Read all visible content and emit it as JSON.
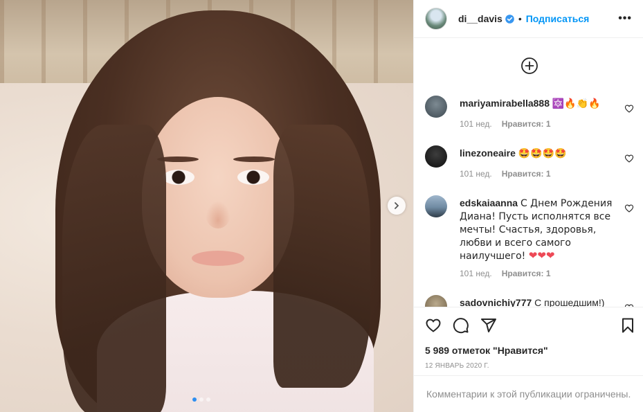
{
  "post": {
    "username": "di__davis",
    "separator": "•",
    "follow_label": "Подписаться",
    "more_label": "•••",
    "likes_text": "5 989 отметок \"Нравится\"",
    "date_text": "12 ЯНВАРЬ 2020 Г.",
    "comments_restricted": "Комментарии к этой публикации ограничены."
  },
  "comments": [
    {
      "user": "mariyamirabella888",
      "text": "🔯🔥👏🔥",
      "time": "101 нед.",
      "likes": "Нравится: 1"
    },
    {
      "user": "linezoneaire",
      "text": "🤩🤩🤩🤩",
      "time": "101 нед.",
      "likes": "Нравится: 1"
    },
    {
      "user": "edskaiaanna",
      "text": "С Днем Рождения Диана! Пусть исполнятся все мечты! Счастья, здоровья, любви и всего самого наилучшего! ❤❤❤",
      "time": "101 нед.",
      "likes": "Нравится: 1"
    },
    {
      "user": "sadovnichiy777",
      "text": "С прошедшим!)",
      "time": "",
      "likes": ""
    }
  ],
  "carousel": {
    "total": 3,
    "current": 1
  },
  "colors": {
    "accent": "#0095f6",
    "verified": "#3897f0",
    "muted": "#8e8e8e",
    "heart_red": "#ed4956"
  },
  "icons": [
    "verified-badge-icon",
    "more-options-icon",
    "plus-circle-icon",
    "heart-icon",
    "comment-icon",
    "share-icon",
    "bookmark-icon",
    "chevron-right-icon"
  ]
}
